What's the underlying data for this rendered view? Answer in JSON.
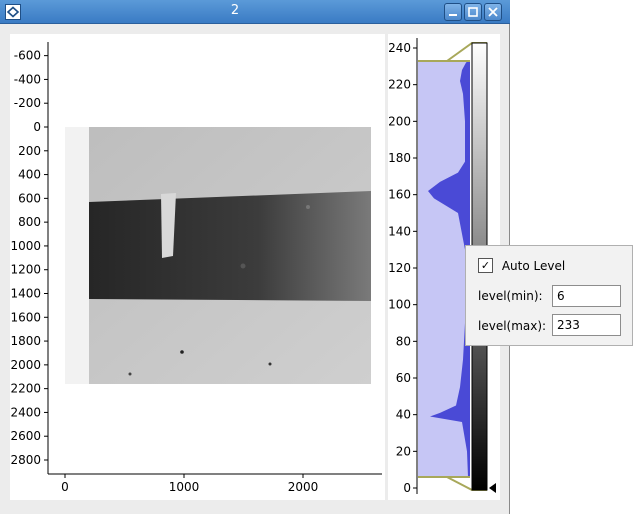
{
  "window": {
    "title": "2",
    "icons": {
      "app": "app-icon",
      "minimize": "minimize-icon",
      "maximize": "maximize-icon",
      "close": "close-icon"
    }
  },
  "image_view": {
    "y_ticks": [
      "-600",
      "-400",
      "-200",
      "0",
      "200",
      "400",
      "600",
      "800",
      "1000",
      "1200",
      "1400",
      "1600",
      "1800",
      "2000",
      "2200",
      "2400",
      "2600",
      "2800"
    ],
    "x_ticks": [
      "0",
      "1000",
      "2000"
    ]
  },
  "histogram": {
    "y_ticks": [
      "0",
      "20",
      "40",
      "60",
      "80",
      "100",
      "120",
      "140",
      "160",
      "180",
      "200",
      "220",
      "240"
    ],
    "level_min": 6,
    "level_max": 233,
    "fill_color": "#4a4ad6",
    "region_color": "#c6c6f5"
  },
  "level_popup": {
    "auto_level_label": "Auto Level",
    "auto_level_checked": "✓",
    "min_label": "level(min):",
    "min_value": "6",
    "max_label": "level(max):",
    "max_value": "233"
  }
}
